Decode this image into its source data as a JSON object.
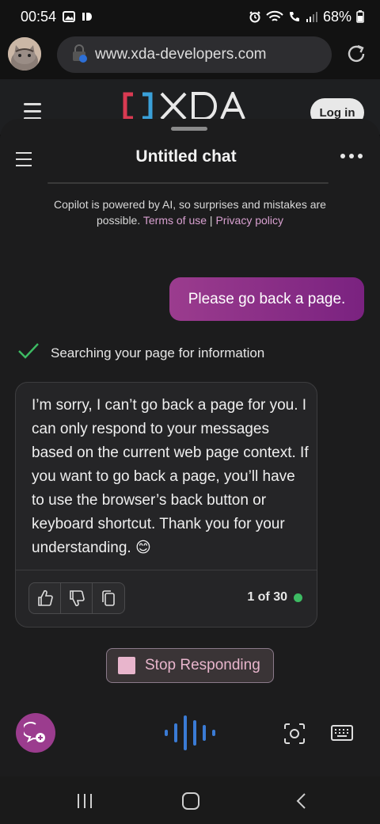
{
  "status_bar": {
    "time": "00:54",
    "battery": "68%"
  },
  "browser": {
    "url": "www.xda-developers.com"
  },
  "site_header": {
    "logo_text": "XDA",
    "login_label": "Log in"
  },
  "chat": {
    "title": "Untitled chat",
    "disclaimer_prefix": "Copilot is powered by AI, so surprises and mistakes are possible. ",
    "terms_label": "Terms of use",
    "separator": " | ",
    "privacy_label": "Privacy policy",
    "user_message": "Please go back a page.",
    "search_status": "Searching your page for information",
    "bot_message": "I’m sorry, I can’t go back a page for you. I can only respond to your messages based on the current web page context. If you want to go back a page, you’ll have to use the browser’s back button or keyboard shortcut. Thank you for your understanding. 😊",
    "counter": "1 of 30",
    "stop_label": "Stop Responding"
  },
  "icons": {
    "gallery": "image-icon",
    "alarm": "alarm-icon",
    "wifi": "wifi-icon",
    "signal": "signal-icon",
    "battery": "battery-icon",
    "lock": "lock-icon",
    "reload": "reload-icon",
    "thumbs_up": "thumbs-up-icon",
    "thumbs_down": "thumbs-down-icon",
    "copy": "copy-icon",
    "new_topic": "new-topic-icon",
    "mic": "microphone-icon",
    "camera": "camera-icon",
    "keyboard": "keyboard-icon"
  },
  "colors": {
    "accent_purple": "#9b3c8e",
    "link_pink": "#d8a0d0",
    "status_green": "#3dbb63",
    "mic_blue": "#3a7bd5"
  }
}
